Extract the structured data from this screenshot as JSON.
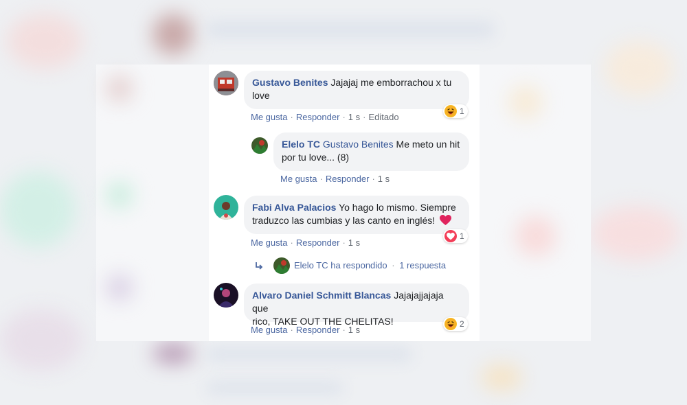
{
  "comments": [
    {
      "author": "Gustavo Benites",
      "text_line1": "Jajajaj me emborrachou x tu",
      "text_line2": "love",
      "actions": {
        "like": "Me gusta",
        "reply": "Responder",
        "time": "1 s",
        "edited": "Editado"
      },
      "reaction": {
        "type": "haha",
        "count": "1"
      }
    },
    {
      "author": "Fabi Alva Palacios",
      "text_line1": "Yo hago lo mismo. Siempre",
      "text_line2": "traduzco las cumbias y las canto en inglés!",
      "actions": {
        "like": "Me gusta",
        "reply": "Responder",
        "time": "1 s"
      },
      "reaction": {
        "type": "love",
        "count": "1"
      }
    },
    {
      "author": "Alvaro Daniel Schmitt Blancas",
      "text_line1": "Jajajajjajaja que",
      "text_line2": "rico, TAKE OUT THE CHELITAS!",
      "actions": {
        "like": "Me gusta",
        "reply": "Responder",
        "time": "1 s"
      },
      "reaction": {
        "type": "haha",
        "count": "2"
      }
    }
  ],
  "reply": {
    "author": "Elelo TC",
    "mention": "Gustavo Benites",
    "text_line1": "Me meto un hit",
    "text_line2": "por tu love... (8)",
    "actions": {
      "like": "Me gusta",
      "reply": "Responder",
      "time": "1 s"
    }
  },
  "replied": {
    "text": "Elelo TC ha respondido",
    "sep": "·",
    "count": "1 respuesta"
  },
  "colors": {
    "link": "#385898",
    "bubble": "#f2f3f5",
    "love": "#f33e58"
  }
}
